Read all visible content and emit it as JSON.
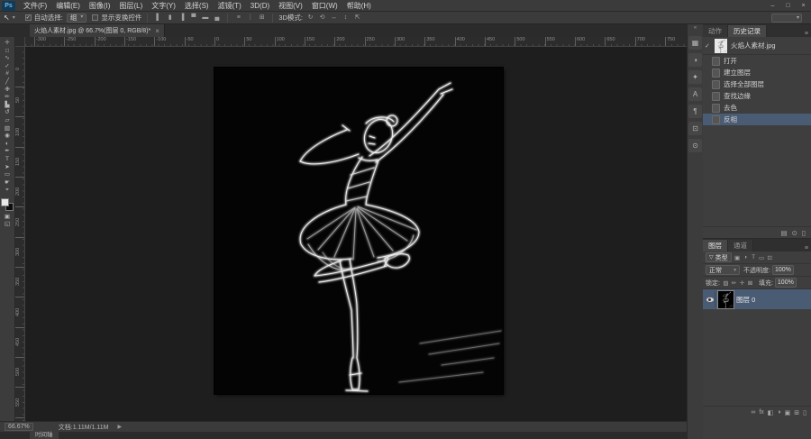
{
  "colors": {
    "selection": "#4a5b74",
    "document_bg": "#040404",
    "figure": "#f0f0f0",
    "foreground_swatch": "#e9e9e9",
    "background_swatch": "#0d0d0d"
  },
  "menu_bar": {
    "logo": "Ps",
    "items": [
      "文件(F)",
      "编辑(E)",
      "图像(I)",
      "图层(L)",
      "文字(Y)",
      "选择(S)",
      "滤镜(T)",
      "3D(D)",
      "视图(V)",
      "窗口(W)",
      "帮助(H)"
    ],
    "window_controls": {
      "minimize": "–",
      "maximize": "□",
      "close": "×"
    }
  },
  "options_bar": {
    "tool_icon": "↖",
    "tool_caret": "▾",
    "auto_select_check": "✓",
    "auto_select_label": "自动选择:",
    "group_value": "组",
    "drop_caret": "▾",
    "show_transform_label": "显示变换控件",
    "align_icons": [
      {
        "name": "align-left",
        "glyph": "▌"
      },
      {
        "name": "align-center-h",
        "glyph": "▮"
      },
      {
        "name": "align-right",
        "glyph": "▐"
      },
      {
        "name": "align-top",
        "glyph": "▀"
      },
      {
        "name": "align-middle",
        "glyph": "▬"
      },
      {
        "name": "align-bottom",
        "glyph": "▄"
      }
    ],
    "distribute_icons": [
      {
        "name": "distribute-v",
        "glyph": "≡"
      },
      {
        "name": "distribute-h",
        "glyph": "⋮"
      },
      {
        "name": "auto-align",
        "glyph": "⊞"
      }
    ],
    "mode_label": "3D模式:",
    "mode_icons": [
      {
        "name": "3d-rotate",
        "glyph": "↻"
      },
      {
        "name": "3d-roll",
        "glyph": "⟲"
      },
      {
        "name": "3d-pan",
        "glyph": "↔"
      },
      {
        "name": "3d-slide",
        "glyph": "↕"
      },
      {
        "name": "3d-scale",
        "glyph": "⇱"
      }
    ],
    "workspace_caret": "▾"
  },
  "document_tab": {
    "title": "火焰人素材.jpg @ 66.7%(图层 0, RGB/8)*",
    "close_glyph": "×"
  },
  "toolbar": {
    "tools": [
      {
        "name": "move",
        "glyph": "✛"
      },
      {
        "name": "marquee",
        "glyph": "□"
      },
      {
        "name": "lasso",
        "glyph": "∿"
      },
      {
        "name": "quick-select",
        "glyph": "✓"
      },
      {
        "name": "crop",
        "glyph": "#"
      },
      {
        "name": "eyedropper",
        "glyph": "╱"
      },
      {
        "name": "spot-healing",
        "glyph": "✙"
      },
      {
        "name": "brush",
        "glyph": "✏"
      },
      {
        "name": "clone-stamp",
        "glyph": "▙"
      },
      {
        "name": "history-brush",
        "glyph": "↺"
      },
      {
        "name": "eraser",
        "glyph": "▱"
      },
      {
        "name": "gradient",
        "glyph": "▧"
      },
      {
        "name": "blur",
        "glyph": "◉"
      },
      {
        "name": "dodge",
        "glyph": "◐"
      },
      {
        "name": "pen",
        "glyph": "✒"
      },
      {
        "name": "type",
        "glyph": "T"
      },
      {
        "name": "path-select",
        "glyph": "➤"
      },
      {
        "name": "shape",
        "glyph": "▭"
      },
      {
        "name": "hand",
        "glyph": "☛"
      },
      {
        "name": "zoom",
        "glyph": "⌖"
      }
    ],
    "extra_tools": [
      {
        "name": "quick-mask",
        "glyph": "▣"
      },
      {
        "name": "screen-mode",
        "glyph": "◱"
      }
    ]
  },
  "rulers": {
    "h_start": -300,
    "h_step": 50,
    "h_count": 22,
    "v_start": 0,
    "v_step": 50,
    "v_count": 12
  },
  "right_strip": {
    "collapse_glyph": "«",
    "icons": [
      {
        "name": "swatches",
        "glyph": "▦"
      },
      {
        "name": "adjustments",
        "glyph": "◑"
      },
      {
        "name": "styles",
        "glyph": "✦"
      },
      {
        "name": "character",
        "glyph": "A"
      },
      {
        "name": "paragraph",
        "glyph": "¶"
      },
      {
        "name": "clone-source",
        "glyph": "⊡"
      },
      {
        "name": "info",
        "glyph": "⊙"
      }
    ]
  },
  "history_panel": {
    "tabs": [
      {
        "label": "动作",
        "active": false
      },
      {
        "label": "历史记录",
        "active": true
      }
    ],
    "menu_glyph": "≡",
    "snapshot": {
      "check_glyph": "✓",
      "label": "火焰人素材.jpg"
    },
    "states": [
      {
        "label": "打开",
        "selected": false
      },
      {
        "label": "建立图层",
        "selected": false
      },
      {
        "label": "选择全部图层",
        "selected": false
      },
      {
        "label": "查找边缘",
        "selected": false
      },
      {
        "label": "去色",
        "selected": false
      },
      {
        "label": "反相",
        "selected": true
      }
    ],
    "bottom_icons": [
      {
        "name": "new-document-from-state",
        "glyph": "▤"
      },
      {
        "name": "new-snapshot",
        "glyph": "⊙"
      },
      {
        "name": "delete-state",
        "glyph": "▯"
      }
    ]
  },
  "layers_panel": {
    "tabs": [
      {
        "label": "图层",
        "active": true
      },
      {
        "label": "通道",
        "active": false
      }
    ],
    "menu_glyph": "≡",
    "filter": {
      "funnel_glyph": "▽",
      "value": "类型",
      "caret": "▾",
      "icons": [
        {
          "name": "filter-pixel",
          "glyph": "▣"
        },
        {
          "name": "filter-adjustment",
          "glyph": "◑"
        },
        {
          "name": "filter-type",
          "glyph": "T"
        },
        {
          "name": "filter-shape",
          "glyph": "▭"
        },
        {
          "name": "filter-smart",
          "glyph": "⊡"
        }
      ]
    },
    "blend_mode": "正常",
    "blend_caret": "▾",
    "opacity_label": "不透明度:",
    "opacity_value": "100%",
    "lock_label": "锁定:",
    "lock_icons": [
      {
        "name": "lock-transparency",
        "glyph": "▨"
      },
      {
        "name": "lock-pixels",
        "glyph": "✏"
      },
      {
        "name": "lock-position",
        "glyph": "✛"
      },
      {
        "name": "lock-all",
        "glyph": "⊠"
      }
    ],
    "fill_label": "填充:",
    "fill_value": "100%",
    "layers": [
      {
        "name": "图层 0",
        "selected": true,
        "visible": true
      }
    ],
    "bottom_icons": [
      {
        "name": "link-layers",
        "glyph": "∞"
      },
      {
        "name": "layer-effects",
        "glyph": "fx"
      },
      {
        "name": "add-mask",
        "glyph": "◧"
      },
      {
        "name": "new-adjustment",
        "glyph": "◑"
      },
      {
        "name": "new-group",
        "glyph": "▣"
      },
      {
        "name": "new-layer",
        "glyph": "⊞"
      },
      {
        "name": "delete-layer",
        "glyph": "▯"
      }
    ]
  },
  "status_bar": {
    "zoom": "66.67%",
    "doc_label": "文档:1.11M/1.11M",
    "expand_glyph": "▶"
  },
  "timeline": {
    "tab_label": "时间轴"
  }
}
